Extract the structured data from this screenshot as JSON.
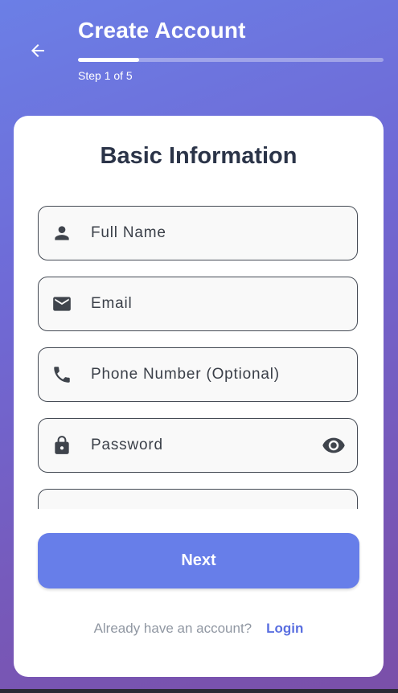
{
  "header": {
    "title": "Create Account",
    "step_label": "Step 1 of 5",
    "progress_fraction": 0.2,
    "back_icon": "arrow-left-icon"
  },
  "card": {
    "title": "Basic Information",
    "fields": [
      {
        "placeholder": "Full Name",
        "icon": "person-icon"
      },
      {
        "placeholder": "Email",
        "icon": "email-icon"
      },
      {
        "placeholder": "Phone Number (Optional)",
        "icon": "phone-icon"
      },
      {
        "placeholder": "Password",
        "icon": "lock-icon",
        "trailing_icon": "eye-icon"
      },
      {
        "placeholder": "",
        "icon": ""
      }
    ],
    "next_label": "Next",
    "footer": {
      "prompt": "Already have an account?",
      "login_label": "Login"
    }
  },
  "colors": {
    "accent": "#677ee9",
    "link": "#5a6fe0",
    "title_text": "#2b3448",
    "muted_text": "#9097a2"
  }
}
